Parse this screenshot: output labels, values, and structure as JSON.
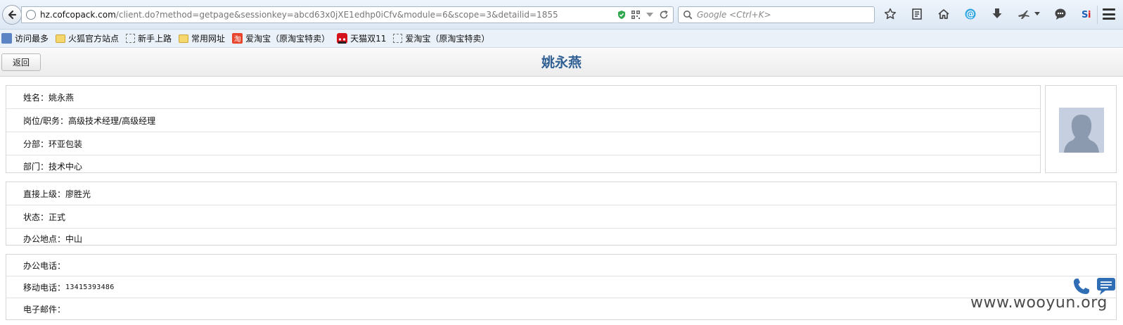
{
  "browser": {
    "url_domain": "hz.cofcopack.com",
    "url_path": "/client.do?method=getpage&sessionkey=abcd63x0jXE1edhp0iCfv&module=6&scope=3&detailid=1855",
    "search_placeholder": "Google <Ctrl+K>",
    "bookmarks": [
      {
        "label": "访问最多",
        "icon": "most-visited-icon"
      },
      {
        "label": "火狐官方站点",
        "icon": "folder-icon"
      },
      {
        "label": "新手上路",
        "icon": "page-icon"
      },
      {
        "label": "常用网址",
        "icon": "folder-icon"
      },
      {
        "label": "爱淘宝（原淘宝特卖）",
        "icon": "taobao-icon"
      },
      {
        "label": "天猫双11",
        "icon": "tmall-icon"
      },
      {
        "label": "爱淘宝（原淘宝特卖）",
        "icon": "page-icon"
      }
    ],
    "taobao_glyph": "淘"
  },
  "page": {
    "back_label": "返回",
    "title": "姚永燕"
  },
  "profile": {
    "name": {
      "label": "姓名：",
      "value": "姚永燕"
    },
    "position": {
      "label": "岗位/职务：",
      "value": "高级技术经理/高级经理"
    },
    "branch": {
      "label": "分部：",
      "value": "环亚包装"
    },
    "department": {
      "label": "部门：",
      "value": "技术中心"
    },
    "supervisor": {
      "label": "直接上级：",
      "value": "廖胜光"
    },
    "status": {
      "label": "状态：",
      "value": "正式"
    },
    "office_location": {
      "label": "办公地点：",
      "value": "中山"
    },
    "office_phone": {
      "label": "办公电话：",
      "value": ""
    },
    "mobile_phone": {
      "label": "移动电话：",
      "value": "13415393486"
    },
    "email": {
      "label": "电子邮件：",
      "value": ""
    }
  },
  "watermark": "www.wooyun.org",
  "colors": {
    "title": "#2f5f93",
    "action_icon": "#2f6db5"
  }
}
